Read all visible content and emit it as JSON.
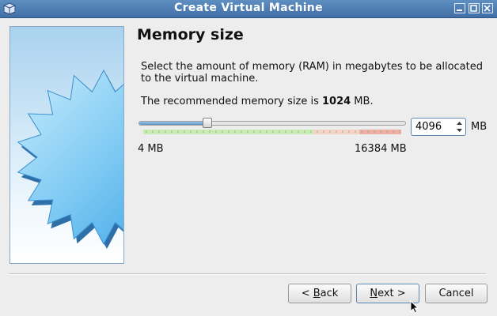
{
  "window": {
    "title": "Create Virtual Machine"
  },
  "page": {
    "heading": "Memory size",
    "description": "Select the amount of memory (RAM) in megabytes to be allocated to the virtual machine.",
    "recommended_prefix": "The recommended memory size is ",
    "recommended_value": "1024",
    "recommended_suffix": " MB."
  },
  "memory": {
    "value": "4096",
    "unit": "MB",
    "min_label": "4 MB",
    "max_label": "16384 MB",
    "min": 4,
    "max": 16384,
    "current": 4096
  },
  "buttons": {
    "back_mnemonic": "B",
    "back_rest": "ack",
    "back_prefix": "< ",
    "next_mnemonic": "N",
    "next_rest": "ext >",
    "cancel": "Cancel"
  },
  "icons": {
    "app": "virtualbox-icon",
    "minimize": "minimize-icon",
    "maximize": "maximize-icon",
    "close": "close-icon"
  },
  "colors": {
    "titlebar": "#4a7ab0",
    "safe_zone": "#c8ecb4",
    "warn_zone": "#f7d2c6",
    "danger_zone": "#f0aea6"
  }
}
